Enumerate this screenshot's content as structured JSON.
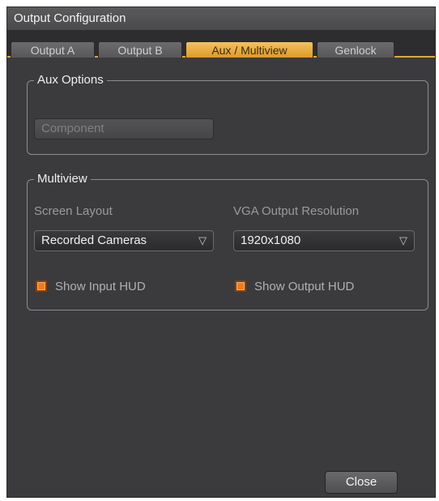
{
  "window": {
    "title": "Output Configuration"
  },
  "tabs": [
    {
      "label": "Output A",
      "active": false
    },
    {
      "label": "Output B",
      "active": false
    },
    {
      "label": "Aux / Multiview",
      "active": true
    },
    {
      "label": "Genlock",
      "active": false
    }
  ],
  "aux_options": {
    "title": "Aux Options",
    "source_button": "Component"
  },
  "multiview": {
    "title": "Multiview",
    "screen_layout": {
      "label": "Screen Layout",
      "value": "Recorded Cameras"
    },
    "vga_resolution": {
      "label": "VGA Output Resolution",
      "value": "1920x1080"
    },
    "show_input_hud": {
      "label": "Show Input HUD",
      "checked": true
    },
    "show_output_hud": {
      "label": "Show Output HUD",
      "checked": true
    }
  },
  "footer": {
    "close_label": "Close"
  },
  "icons": {
    "dropdown": "dropdown-triangle-icon",
    "arrow_glyph": "▽"
  },
  "colors": {
    "accent": "#e3a63a",
    "checkbox": "#f07b1e",
    "panel": "#3b3b3d"
  }
}
